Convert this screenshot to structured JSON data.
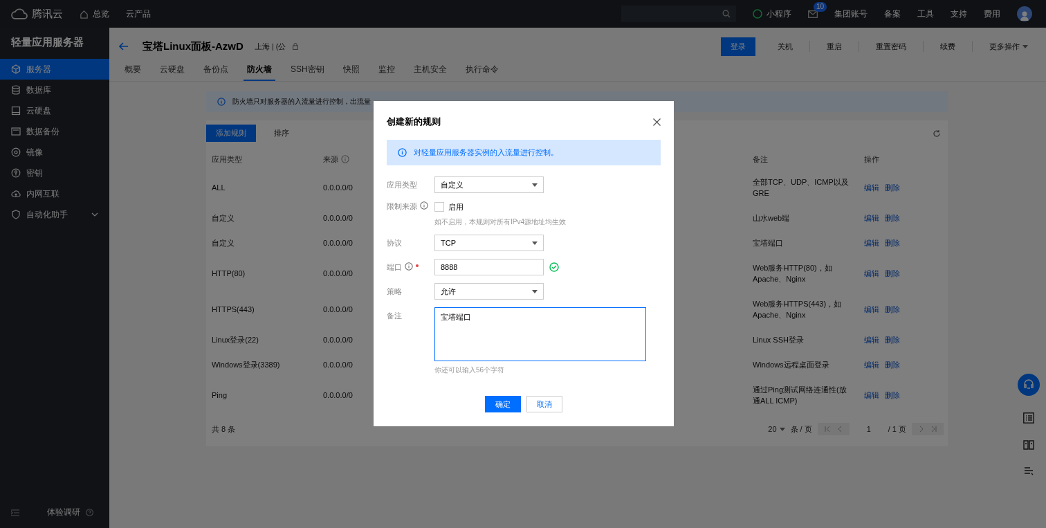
{
  "topbar": {
    "logo": "腾讯云",
    "nav": [
      "总览",
      "云产品"
    ],
    "miniapp": "小程序",
    "mail_badge": "10",
    "links": [
      "集团账号",
      "备案",
      "工具",
      "支持",
      "费用"
    ]
  },
  "sidebar": {
    "title": "轻量应用服务器",
    "items": [
      {
        "label": "服务器",
        "selected": true,
        "has_children": false
      },
      {
        "label": "数据库",
        "selected": false,
        "has_children": false
      },
      {
        "label": "云硬盘",
        "selected": false,
        "has_children": false
      },
      {
        "label": "数据备份",
        "selected": false,
        "has_children": false
      },
      {
        "label": "镜像",
        "selected": false,
        "has_children": false
      },
      {
        "label": "密钥",
        "selected": false,
        "has_children": false
      },
      {
        "label": "内网互联",
        "selected": false,
        "has_children": false
      },
      {
        "label": "自动化助手",
        "selected": false,
        "has_children": true
      }
    ],
    "footer": "体验调研"
  },
  "header": {
    "title": "宝塔Linux面板-AzwD",
    "region": "上海 | (公",
    "buttons": [
      {
        "label": "登录",
        "primary": true,
        "caret": false
      },
      {
        "label": "关机",
        "primary": false,
        "caret": false
      },
      {
        "label": "重启",
        "primary": false,
        "caret": false
      },
      {
        "label": "重置密码",
        "primary": false,
        "caret": false
      },
      {
        "label": "续费",
        "primary": false,
        "caret": false
      },
      {
        "label": "更多操作",
        "primary": false,
        "caret": true
      }
    ]
  },
  "tabs": [
    {
      "label": "概要",
      "selected": false
    },
    {
      "label": "云硬盘",
      "selected": false
    },
    {
      "label": "备份点",
      "selected": false
    },
    {
      "label": "防火墙",
      "selected": true
    },
    {
      "label": "SSH密钥",
      "selected": false
    },
    {
      "label": "快照",
      "selected": false
    },
    {
      "label": "监控",
      "selected": false
    },
    {
      "label": "主机安全",
      "selected": false
    },
    {
      "label": "执行命令",
      "selected": false
    }
  ],
  "notice": "防火墙只对服务器的入流量进行控制，出流量",
  "toolbar": [
    {
      "label": "添加规则",
      "primary": true
    },
    {
      "label": "排序",
      "primary": false
    }
  ],
  "table": {
    "columns": [
      {
        "label": "应用类型",
        "info": false
      },
      {
        "label": "来源",
        "info": true
      },
      {
        "label": "备注",
        "info": false
      },
      {
        "label": "操作",
        "info": false
      }
    ],
    "rows": [
      {
        "type": "ALL",
        "source": "0.0.0.0/0",
        "note": "全部TCP、UDP、ICMP以及GRE",
        "actions": [
          "编辑",
          "删除"
        ]
      },
      {
        "type": "自定义",
        "source": "0.0.0.0/0",
        "note": "山水web端",
        "actions": [
          "编辑",
          "删除"
        ]
      },
      {
        "type": "自定义",
        "source": "0.0.0.0/0",
        "note": "宝塔端口",
        "actions": [
          "编辑",
          "删除"
        ]
      },
      {
        "type": "HTTP(80)",
        "source": "0.0.0.0/0",
        "note": "Web服务HTTP(80)，如Apache、Nginx",
        "actions": [
          "编辑",
          "删除"
        ]
      },
      {
        "type": "HTTPS(443)",
        "source": "0.0.0.0/0",
        "note": "Web服务HTTPS(443)，如Apache、Nginx",
        "actions": [
          "编辑",
          "删除"
        ]
      },
      {
        "type": "Linux登录(22)",
        "source": "0.0.0.0/0",
        "note": "Linux SSH登录",
        "actions": [
          "编辑",
          "删除"
        ]
      },
      {
        "type": "Windows登录(3389)",
        "source": "0.0.0.0/0",
        "note": "Windows远程桌面登录",
        "actions": [
          "编辑",
          "删除"
        ]
      },
      {
        "type": "Ping",
        "source": "0.0.0.0/0",
        "note": "通过Ping测试网络连通性(放通ALL ICMP)",
        "actions": [
          "编辑",
          "删除"
        ]
      }
    ],
    "total": "共 8 条",
    "page_size": "20",
    "per_page": "条 / 页",
    "page": "1",
    "pages": "/ 1 页"
  },
  "dialog": {
    "title": "创建新的规则",
    "info": "对轻量应用服务器实例的入流量进行控制。",
    "fields": [
      {
        "label": "应用类型",
        "kind": "select",
        "value": "自定义",
        "info": false,
        "required": false,
        "valid": false,
        "focused": false
      },
      {
        "label": "限制来源",
        "kind": "checkbox",
        "option": "启用",
        "checked": false,
        "hint": "如不启用，本规则对所有IPv4源地址均生效",
        "info": true,
        "required": false,
        "valid": false,
        "focused": false
      },
      {
        "label": "协议",
        "kind": "select",
        "value": "TCP",
        "info": false,
        "required": false,
        "valid": false,
        "focused": false
      },
      {
        "label": "端口",
        "kind": "input",
        "value": "8888",
        "info": true,
        "required": true,
        "valid": true,
        "focused": false
      },
      {
        "label": "策略",
        "kind": "select",
        "value": "允许",
        "info": false,
        "required": false,
        "valid": false,
        "focused": false
      },
      {
        "label": "备注",
        "kind": "textarea",
        "value": "宝塔端口",
        "hint": "你还可以输入56个字符",
        "info": false,
        "required": false,
        "valid": false,
        "focused": true
      }
    ],
    "buttons": [
      {
        "label": "确定",
        "primary": true
      },
      {
        "label": "取消",
        "primary": false
      }
    ]
  }
}
